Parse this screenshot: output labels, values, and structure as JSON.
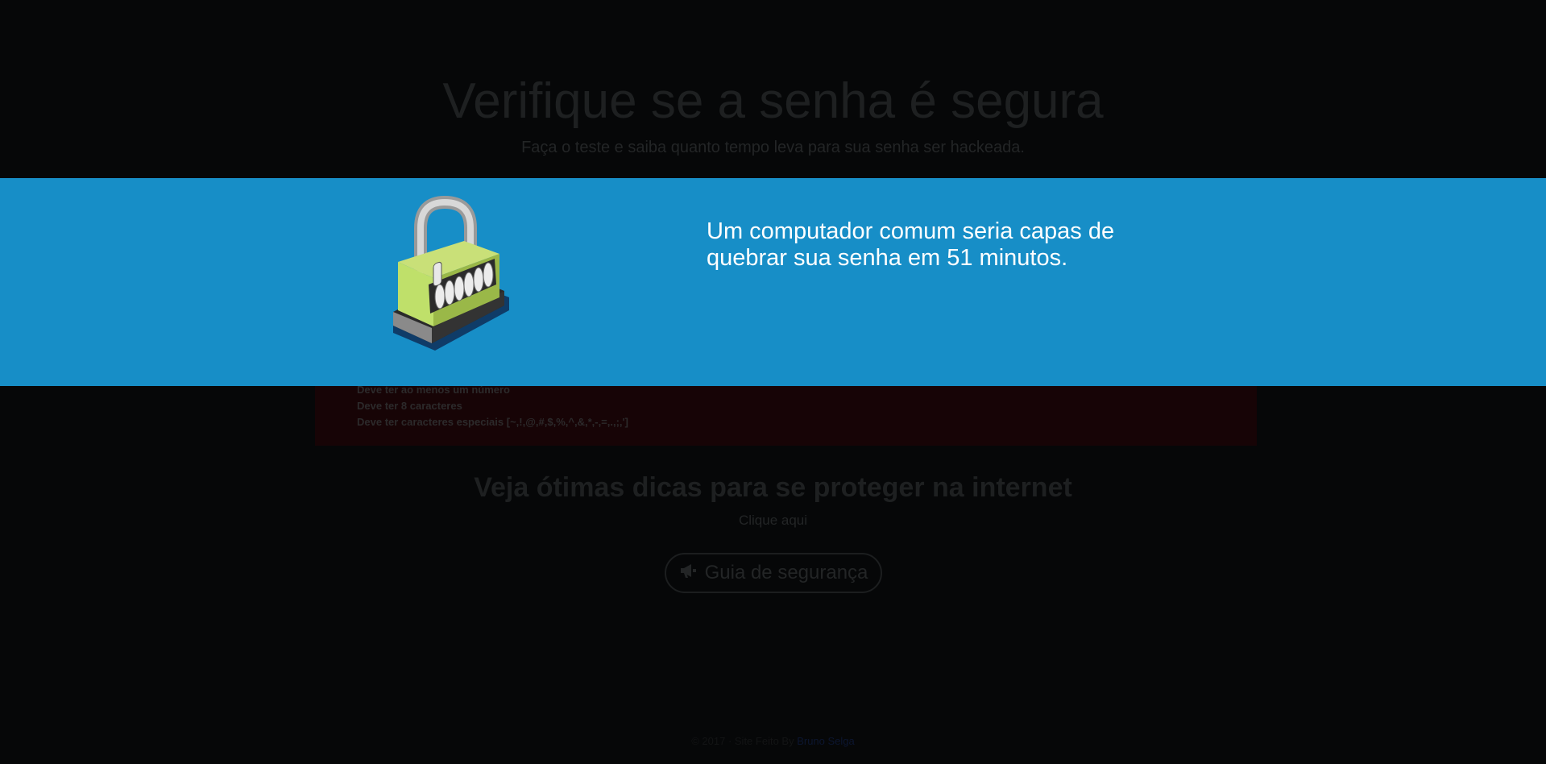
{
  "hero": {
    "title": "Verifique se a senha é segura",
    "subtitle": "Faça o teste e saiba quanto tempo leva para sua senha ser hackeada."
  },
  "requirements": {
    "items": [
      "Deve ter ao menos um número",
      "Deve ter 8 caracteres",
      "Deve ter caracteres especiais [~,!,@,#,$,%,^,&,*,-,=,.,;,']"
    ]
  },
  "tips": {
    "title": "Veja ótimas dicas para se proteger na internet",
    "link_text": "Clique aqui",
    "button_label": "Guia de segurança",
    "button_icon": "megaphone-icon"
  },
  "footer": {
    "text": "© 2017 · Site Feito By",
    "author": "Bruno Selga"
  },
  "modal": {
    "message": "Um computador comum seria capas de quebrar sua senha em 51 minutos.",
    "image": "combination-padlock-illustration",
    "background_color": "#178ec7"
  }
}
